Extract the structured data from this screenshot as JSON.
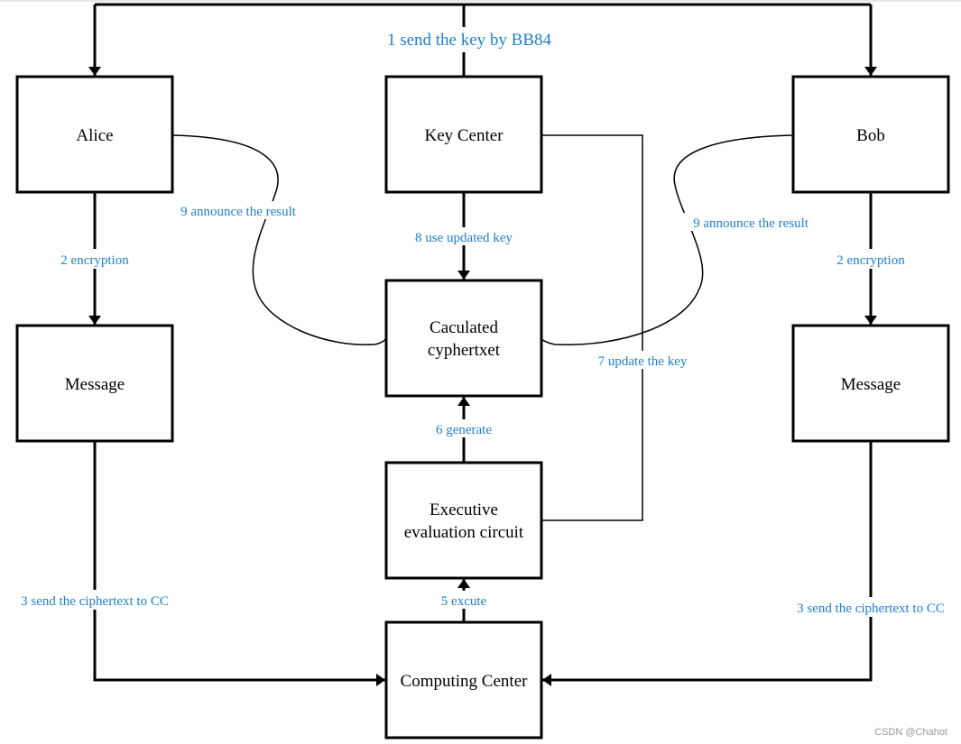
{
  "nodes": {
    "alice": "Alice",
    "key_center": "Key Center",
    "bob": "Bob",
    "message_left": "Message",
    "calculated_line1": "Caculated",
    "calculated_line2": "cyphertxet",
    "message_right": "Message",
    "executive_line1": "Executive",
    "executive_line2": "evaluation circuit",
    "computing_center": "Computing Center"
  },
  "edges": {
    "e1": "1 send the key by BB84",
    "e2_left": "2 encryption",
    "e2_right": "2 encryption",
    "e3_left": "3 send the ciphertext to CC",
    "e3_right": "3 send the ciphertext to CC",
    "e5": "5 excute",
    "e6": "6 generate",
    "e7": "7 update the key",
    "e8": "8 use updated key",
    "e9_left": "9 announce the result",
    "e9_right": "9 announce the result"
  },
  "colors": {
    "label": "#1f80cf",
    "stroke": "#000000"
  },
  "watermark": "CSDN @Chahot"
}
